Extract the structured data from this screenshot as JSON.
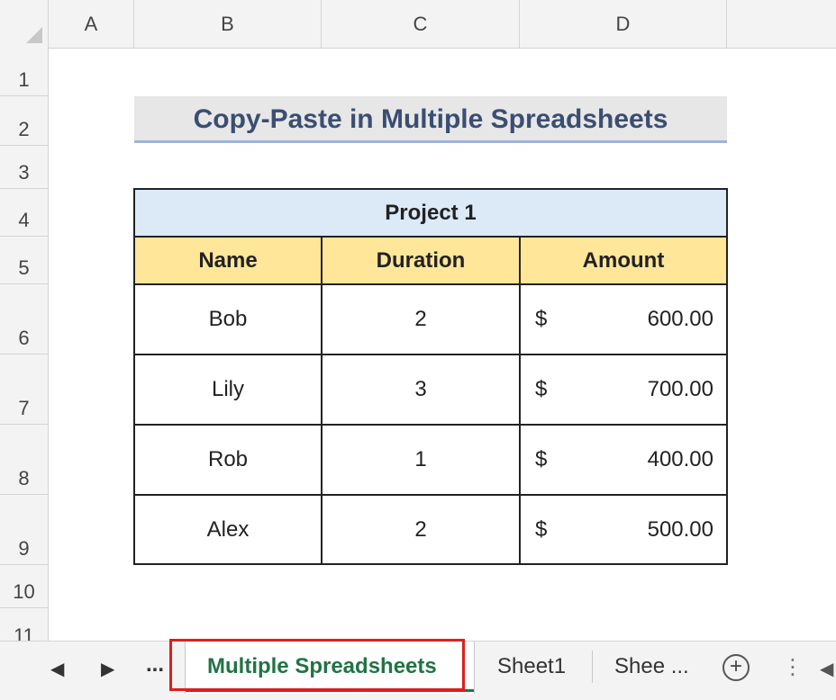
{
  "columns": [
    "A",
    "B",
    "C",
    "D"
  ],
  "rows": [
    "1",
    "2",
    "3",
    "4",
    "5",
    "6",
    "7",
    "8",
    "9",
    "10",
    "11"
  ],
  "title": "Copy-Paste in Multiple Spreadsheets",
  "table": {
    "project": "Project 1",
    "headers": [
      "Name",
      "Duration",
      "Amount"
    ],
    "rows": [
      {
        "name": "Bob",
        "duration": "2",
        "currency": "$",
        "amount": "600.00"
      },
      {
        "name": "Lily",
        "duration": "3",
        "currency": "$",
        "amount": "700.00"
      },
      {
        "name": "Rob",
        "duration": "1",
        "currency": "$",
        "amount": "400.00"
      },
      {
        "name": "Alex",
        "duration": "2",
        "currency": "$",
        "amount": "500.00"
      }
    ]
  },
  "tabbar": {
    "prev_icon": "◀",
    "next_icon": "▶",
    "more_left": "...",
    "active_tab": "Multiple Spreadsheets",
    "tabs": [
      "Sheet1",
      "Shee ..."
    ],
    "add_icon": "+",
    "options_icon": "⋮",
    "scroll_left_icon": "◀"
  },
  "colors": {
    "accent": "#217346",
    "highlight": "#e01d1d",
    "header_fill": "#ffe699",
    "project_fill": "#dce9f7"
  }
}
